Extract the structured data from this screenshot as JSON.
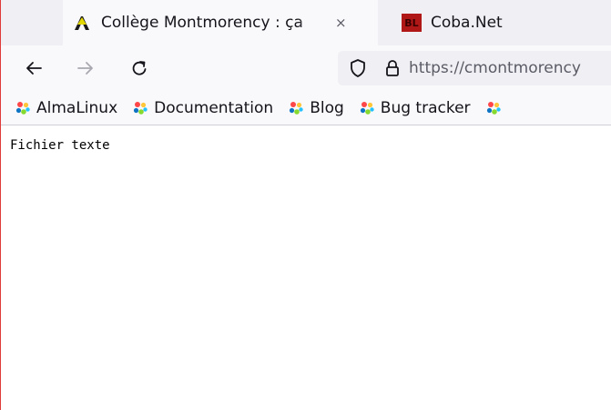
{
  "tabs": [
    {
      "title": "Collège Montmorency : ça",
      "close": "×",
      "active": true,
      "favicon": "almalinux-a-icon"
    },
    {
      "title": "Coba.Net",
      "active": false,
      "favicon": "coba-logo-icon"
    }
  ],
  "nav": {
    "back_icon": "arrow-left-icon",
    "forward_icon": "arrow-right-icon",
    "reload_icon": "reload-icon",
    "url": "https://cmontmorency"
  },
  "bookmarks": [
    {
      "label": "AlmaLinux",
      "icon": "almalinux-icon"
    },
    {
      "label": "Documentation",
      "icon": "almalinux-icon"
    },
    {
      "label": "Blog",
      "icon": "almalinux-icon"
    },
    {
      "label": "Bug tracker",
      "icon": "almalinux-icon"
    }
  ],
  "page": {
    "text": "Fichier texte"
  },
  "colors": {
    "tabstrip_bg": "#f0f0f4",
    "active_tab_bg": "#f9f9fb",
    "frame_border": "#e03a3a",
    "coba_red": "#b01818"
  }
}
